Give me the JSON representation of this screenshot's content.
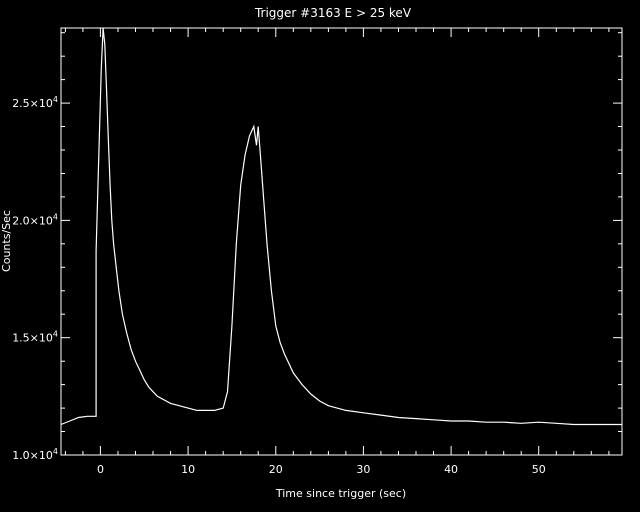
{
  "chart_data": {
    "type": "line",
    "title": "Trigger #3163 E > 25 keV",
    "xlabel": "Time since trigger (sec)",
    "ylabel": "Counts/Sec",
    "xlim": [
      -4.5,
      59.5
    ],
    "ylim": [
      10000,
      28200
    ],
    "x_ticks": [
      0,
      10,
      20,
      30,
      40,
      50
    ],
    "y_ticks": [
      {
        "value": 10000,
        "mantissa": "1.0",
        "base": "×10",
        "exp": "4"
      },
      {
        "value": 15000,
        "mantissa": "1.5",
        "base": "×10",
        "exp": "4"
      },
      {
        "value": 20000,
        "mantissa": "2.0",
        "base": "×10",
        "exp": "4"
      },
      {
        "value": 25000,
        "mantissa": "2.5",
        "base": "×10",
        "exp": "4"
      }
    ],
    "grid": false,
    "series": [
      {
        "x": [
          -4.5,
          -3.5,
          -2.5,
          -1.5,
          -0.5,
          -0.5,
          0.1,
          0.3,
          0.5,
          0.7,
          0.9,
          1.1,
          1.3,
          1.5,
          1.8,
          2.1,
          2.5,
          3.0,
          3.5,
          4.0,
          4.5,
          5.0,
          5.5,
          6.0,
          6.5,
          7.0,
          7.5,
          8.0,
          8.5,
          9.0,
          9.5,
          10.0,
          11.0,
          12.0,
          13.0,
          14.0,
          14.5,
          15.0,
          15.5,
          16.0,
          16.5,
          17.0,
          17.5,
          17.8,
          18.0,
          18.3,
          18.6,
          19.0,
          19.5,
          20.0,
          20.5,
          21.0,
          21.5,
          22.0,
          23.0,
          24.0,
          25.0,
          26.0,
          27.0,
          28.0,
          30.0,
          32.0,
          34.0,
          36.0,
          38.0,
          40.0,
          42.0,
          44.0,
          46.0,
          48.0,
          50.0,
          52.0,
          54.0,
          56.0,
          58.0,
          59.5
        ],
        "values": [
          11300,
          11450,
          11600,
          11650,
          11650,
          18700,
          26500,
          28200,
          27500,
          25500,
          23500,
          21500,
          20000,
          19000,
          18000,
          17000,
          16000,
          15200,
          14500,
          14000,
          13600,
          13200,
          12900,
          12700,
          12500,
          12400,
          12300,
          12200,
          12150,
          12100,
          12050,
          12000,
          11900,
          11900,
          11900,
          12000,
          12700,
          15500,
          19000,
          21500,
          22800,
          23600,
          24000,
          23200,
          24000,
          22500,
          21000,
          19000,
          17000,
          15500,
          14800,
          14300,
          13900,
          13500,
          13000,
          12600,
          12300,
          12100,
          12000,
          11900,
          11800,
          11700,
          11600,
          11550,
          11500,
          11450,
          11450,
          11400,
          11400,
          11350,
          11400,
          11350,
          11300,
          11300,
          11300,
          11300
        ]
      }
    ]
  }
}
